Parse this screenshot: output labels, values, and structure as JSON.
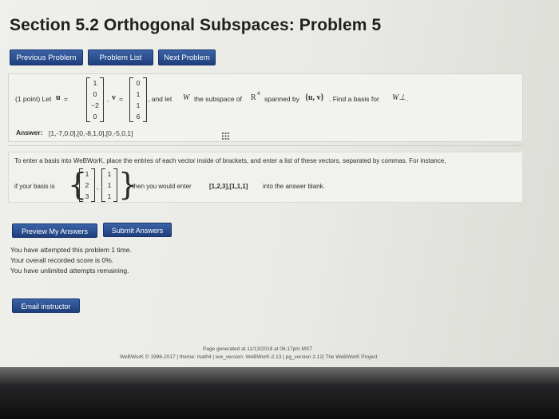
{
  "page": {
    "title": "Section 5.2 Orthogonal Subspaces: Problem 5"
  },
  "nav": {
    "previous": "Previous Problem",
    "list": "Problem List",
    "next": "Next Problem"
  },
  "problem": {
    "points": "(1 point) Let",
    "u_symbol": "u",
    "equals": "=",
    "u_vector": [
      "1",
      "0",
      "−2",
      "0"
    ],
    "v_symbol": "v",
    "v_vector": [
      "0",
      "1",
      "1",
      "6"
    ],
    "text_after": ", and let",
    "w_symbol": "W",
    "text_subspace": "the subspace of",
    "r_symbol": "R",
    "r_exp": "4",
    "text_spanned": "spanned by",
    "span_set": "{u, v}",
    "text_find": ". Find a basis for",
    "w_perp": "W⊥",
    "period": "."
  },
  "answer": {
    "label": "Answer:",
    "value": "[1,-7,0,0],[0,-8,1,0],[0,-5,0,1]"
  },
  "instructions": {
    "line1": "To enter a basis into WeBWorK, place the entries of each vector inside of brackets, and enter a list of these vectors, separated by commas. For instance,",
    "prefix": "if your basis is",
    "vector1": [
      "1",
      "2",
      "3"
    ],
    "vector2": [
      "1",
      "1",
      "1"
    ],
    "suffix_before": ", then you would enter",
    "example": "[1,2,3],[1,1,1]",
    "suffix_after": "into the answer blank."
  },
  "buttons": {
    "preview": "Preview My Answers",
    "submit": "Submit Answers",
    "email": "Email instructor"
  },
  "status": {
    "attempts": "You have attempted this problem 1 time.",
    "score": "Your overall recorded score is 0%.",
    "remaining": "You have unlimited attempts remaining."
  },
  "footer": {
    "generated": "Page generated at 11/13/2018 at 06:17pm MST",
    "copyright": "WeBWorK © 1996-2017 | theme: math4 | ww_version: WeBWorK-2.13 | pg_version 2.12| The WeBWorK Project"
  },
  "colors": {
    "button": "#2a4d8f",
    "background": "#ececE8"
  }
}
